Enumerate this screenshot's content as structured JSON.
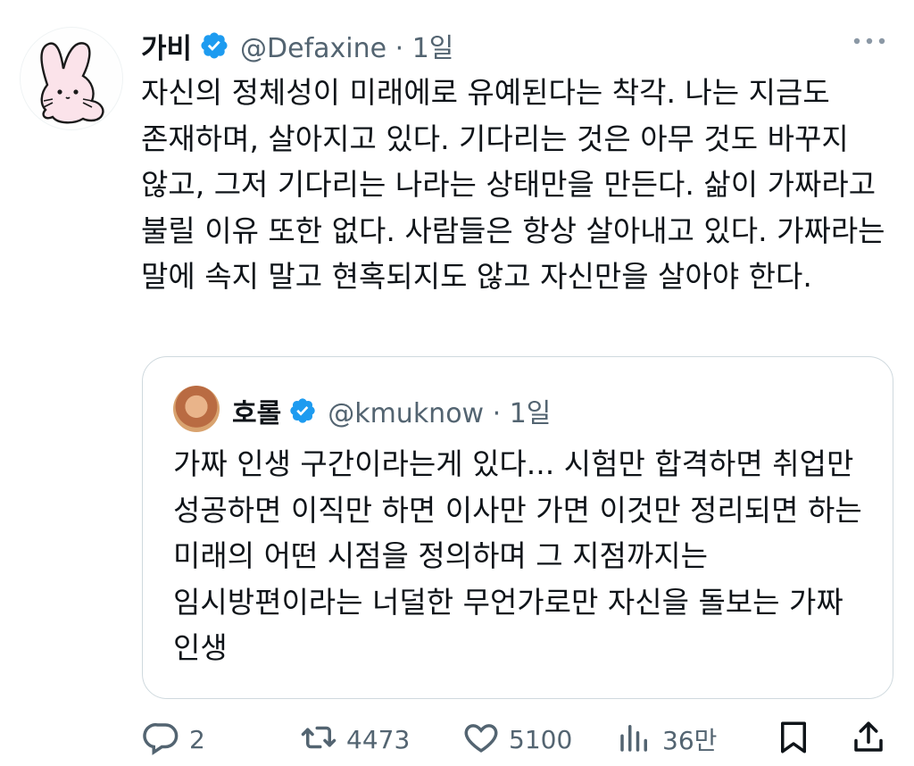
{
  "tweet": {
    "display_name": "가비",
    "handle_line": "@Defaxine · 1일",
    "text": "자신의 정체성이 미래에로 유예된다는 착각. 나는 지금도 존재하며, 살아지고 있다. 기다리는 것은 아무 것도 바꾸지 않고, 그저 기다리는 나라는 상태만을 만든다. 삶이 가짜라고 불릴 이유 또한 없다. 사람들은 항상 살아내고 있다. 가짜라는 말에 속지 말고 현혹되지도 않고 자신만을 살아야 한다."
  },
  "quote": {
    "display_name": "호롤",
    "handle_line": "@kmuknow · 1일",
    "text": "가짜 인생 구간이라는게 있다... 시험만 합격하면 취업만 성공하면 이직만 하면 이사만 가면 이것만 정리되면 하는 미래의 어떤 시점을 정의하며 그 지점까지는 임시방편이라는 너덜한 무언가로만 자신을 돌보는 가짜 인생"
  },
  "actions": {
    "replies": "2",
    "retweets": "4473",
    "likes": "5100",
    "views": "36만"
  },
  "colors": {
    "verified": "#1d9bf0",
    "text": "#0f1419",
    "secondary": "#536471",
    "border": "#cfd9de"
  },
  "icons": [
    "more-icon",
    "verified-badge-icon",
    "reply-icon",
    "retweet-icon",
    "like-icon",
    "views-icon",
    "bookmark-icon",
    "share-icon"
  ]
}
